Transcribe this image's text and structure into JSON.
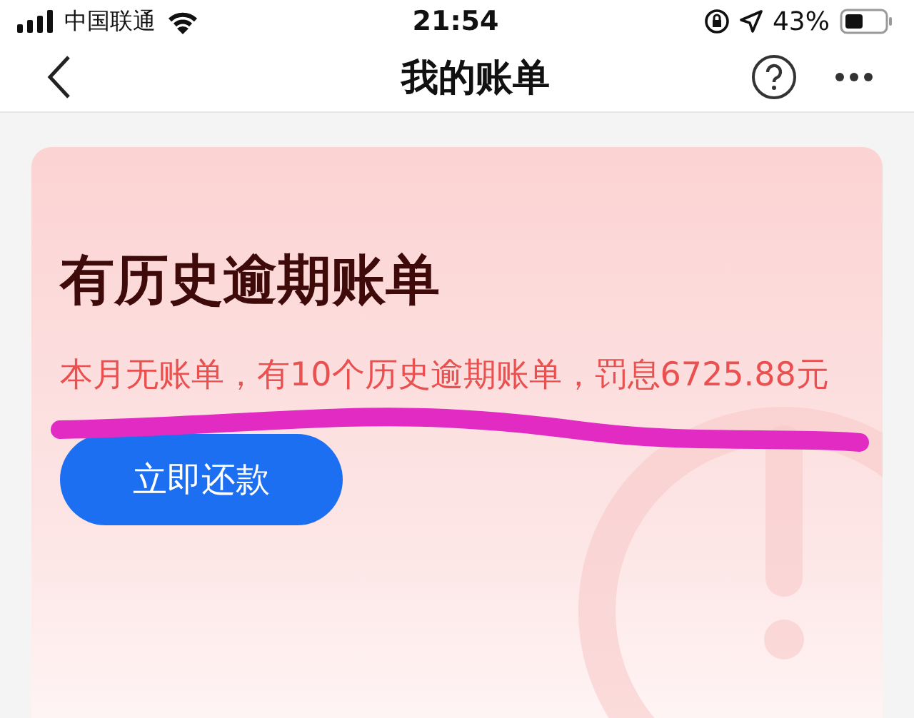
{
  "status_bar": {
    "carrier": "中国联通",
    "time": "21:54",
    "battery": "43%"
  },
  "nav": {
    "title": "我的账单"
  },
  "card": {
    "title": "有历史逾期账单",
    "description": "本月无账单，有10个历史逾期账单，罚息6725.88元",
    "button": "立即还款"
  }
}
